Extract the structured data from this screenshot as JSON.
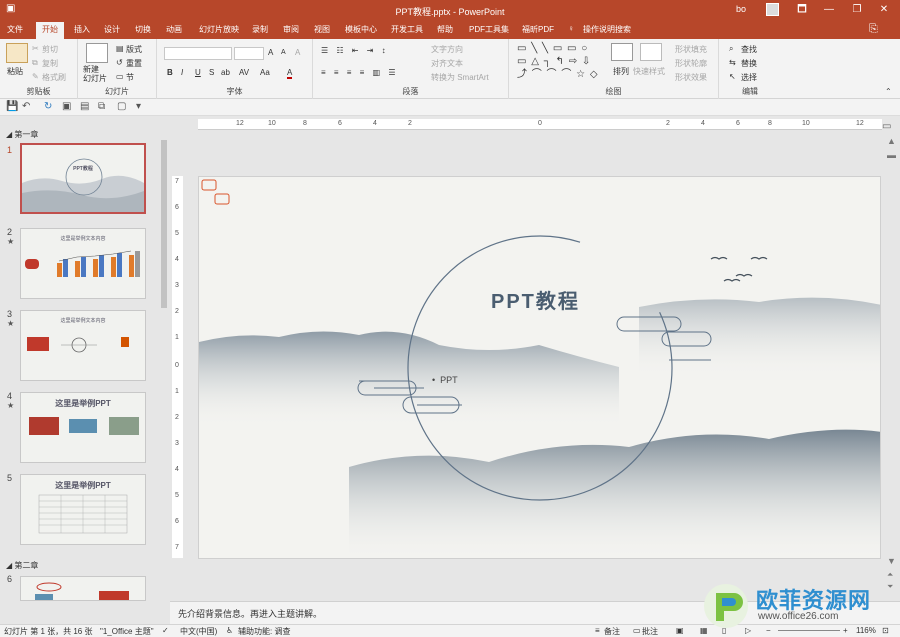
{
  "titlebar": {
    "title": "PPT教程.pptx  -  PowerPoint",
    "user": "bo",
    "minimize": "—",
    "restore": "❐",
    "close": "✕",
    "ribbon_display": "🗖"
  },
  "tabs": [
    "文件",
    "开始",
    "插入",
    "设计",
    "切换",
    "动画",
    "幻灯片放映",
    "录制",
    "审阅",
    "视图",
    "模板中心",
    "开发工具",
    "帮助",
    "PDF工具集",
    "福昕PDF",
    "操作说明搜索"
  ],
  "ribbon": {
    "clipboard": {
      "paste": "粘贴",
      "cut": "剪切",
      "copy": "复制",
      "format_painter": "格式刷",
      "label": "剪贴板"
    },
    "slides": {
      "new_slide": "新建\n幻灯片",
      "layout": "版式",
      "reset": "重置",
      "section": "节",
      "label": "幻灯片"
    },
    "font": {
      "label": "字体",
      "bold": "B",
      "italic": "I",
      "underline": "U",
      "strike": "S",
      "shadow": "ab",
      "spacing": "AV",
      "case": "Aa",
      "grow": "A",
      "shrink": "A",
      "clear": "A",
      "color": "A"
    },
    "paragraph": {
      "label": "段落",
      "text_direction": "文字方向",
      "align_text": "对齐文本",
      "convert_smartart": "转换为 SmartArt"
    },
    "drawing": {
      "label": "绘图",
      "arrange": "排列",
      "quick_styles": "快速样式",
      "fill": "形状填充",
      "outline": "形状轮廓",
      "effects": "形状效果"
    },
    "editing": {
      "label": "编辑",
      "find": "查找",
      "replace": "替换",
      "select": "选择"
    }
  },
  "sections": [
    "第一章",
    "第二章"
  ],
  "thumbnails": [
    {
      "num": "1",
      "title": "PPT教程",
      "star": ""
    },
    {
      "num": "2",
      "title": "这里是举例文本内容",
      "star": "★"
    },
    {
      "num": "3",
      "title": "这里是举例文本内容",
      "star": "★"
    },
    {
      "num": "4",
      "title": "这里是举例PPT",
      "star": "★"
    },
    {
      "num": "5",
      "title": "这里是举例PPT",
      "star": ""
    },
    {
      "num": "6",
      "title": "",
      "star": ""
    }
  ],
  "ruler_h": [
    "12",
    "10",
    "8",
    "6",
    "4",
    "2",
    "0",
    "2",
    "4",
    "6",
    "8",
    "10",
    "12"
  ],
  "ruler_v": [
    "7",
    "6",
    "5",
    "4",
    "3",
    "2",
    "1",
    "0",
    "1",
    "2",
    "3",
    "4",
    "5",
    "6",
    "7"
  ],
  "slide": {
    "title": "PPT教程",
    "bullet": "PPT"
  },
  "notes": "先介绍背景信息。再进入主题讲解。",
  "status": {
    "slide_info": "幻灯片 第 1 张，共 16 张",
    "theme": "\"1_Office 主题\"",
    "language": "中文(中国)",
    "accessibility": "辅助功能: 调查",
    "notes_btn": "备注",
    "comments_btn": "批注",
    "zoom": "116%"
  },
  "brand": {
    "name": "欧菲资源网",
    "url": "www.office26.com"
  },
  "colors": {
    "accent": "#b7472a",
    "slide_title": "#4a5d70",
    "brand_blue": "#2f8fd0",
    "brand_green": "#7cc242"
  }
}
